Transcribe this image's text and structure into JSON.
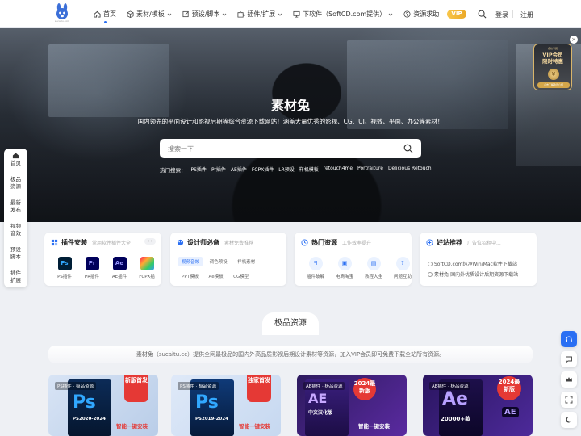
{
  "header": {
    "logo_sub": "sucaitu.com",
    "nav": [
      {
        "label": "首页",
        "icon": "home-icon",
        "active": true,
        "caret": false
      },
      {
        "label": "素材/模板",
        "icon": "box-icon",
        "active": false,
        "caret": true
      },
      {
        "label": "预设/脚本",
        "icon": "edit-icon",
        "active": false,
        "caret": true
      },
      {
        "label": "插件/扩展",
        "icon": "puzzle-icon",
        "active": false,
        "caret": true
      },
      {
        "label": "下软件（SoftCD.com提供）",
        "icon": "monitor-icon",
        "active": false,
        "caret": true
      },
      {
        "label": "资源求助",
        "icon": "help-icon",
        "active": false,
        "caret": false
      }
    ],
    "vip": "VIP",
    "login": "登录",
    "register": "注册"
  },
  "hero": {
    "title": "素材兔",
    "subtitle": "国内领先的平面设计和影视后期等综合资源下载网站！涵盖大量优秀的影视、CG、UI、视效、平面、办公等素材！",
    "search_placeholder": "搜索一下",
    "hot_label": "热门搜索：",
    "hot_terms": [
      "PS插件",
      "Pr插件",
      "AE插件",
      "FCPX插件",
      "LR预设",
      "样机模板",
      "retouch4me",
      "Portraiture",
      "Delicious Retouch"
    ]
  },
  "vip_badge": {
    "top": "名校专属",
    "title_line1": "VIP会员",
    "title_line2": "限时特惠",
    "coin": "¥",
    "button": "点击了解会员介绍"
  },
  "left_sidebar": [
    {
      "label": "首页",
      "icon": "home-icon"
    },
    {
      "label": "极品资源"
    },
    {
      "label": "最新发布"
    },
    {
      "label": "视频音效"
    },
    {
      "label": "预设脚本"
    },
    {
      "label": "插件扩展"
    }
  ],
  "cards": {
    "plugins": {
      "title": "插件安装",
      "subtitle": "常用软件插件大全",
      "arrows": "‹ ›",
      "items": [
        {
          "label": "PS插件",
          "abbr": "Ps",
          "color": "#001e36",
          "text_color": "#31a8ff"
        },
        {
          "label": "PR插件",
          "abbr": "Pr",
          "color": "#00005b",
          "text_color": "#9999ff"
        },
        {
          "label": "AE插件",
          "abbr": "Ae",
          "color": "#00005b",
          "text_color": "#9999ff"
        },
        {
          "label": "FCPX插",
          "abbr": "🎬",
          "color": "#222222",
          "text_color": "#ffffff"
        }
      ]
    },
    "design": {
      "title": "设计师必备",
      "subtitle": "素材免费推荐",
      "tags": [
        "视频音效",
        "调色预设",
        "样机素材",
        "PPT模板",
        "Ae模板",
        "CG模型"
      ]
    },
    "hot": {
      "title": "热门资源",
      "subtitle": "工作效率提升",
      "items": [
        {
          "label": "插件破解",
          "icon": "wrench-icon"
        },
        {
          "label": "电商淘宝",
          "icon": "bag-icon"
        },
        {
          "label": "教程大全",
          "icon": "book-icon"
        },
        {
          "label": "问题互助",
          "icon": "question-icon"
        }
      ]
    },
    "links": {
      "title": "好站推荐",
      "subtitle": "广告位招租中...",
      "items": [
        "SoftCD.com纯净Win/Mac软件下载站",
        "素材兔-国内外优质设计后期资源下载站"
      ]
    }
  },
  "section": {
    "title": "极品资源",
    "notice": "素材兔（sucaitu.cc）提供全网最极品的国内外高品质影视后期设计素材等资源，加入VIP会员即可免费下载全站所有资源。"
  },
  "products": [
    {
      "label": "PS插件 · 极品资源",
      "big": "Ps",
      "sub": "PS2020-2024",
      "corner": "新版首发",
      "bottom": "智能一键安装"
    },
    {
      "label": "PS插件 · 极品资源",
      "big": "Ps",
      "sub": "PS2019-2024",
      "corner": "独家首发",
      "bottom": "智能一键安装"
    },
    {
      "label": "AE插件 · 极品资源",
      "big": "AE",
      "sub": "中文汉化版",
      "corner": "2024最新版",
      "bottom": "智能一键安装"
    },
    {
      "label": "AE插件 · 极品资源",
      "big": "Ae",
      "sub": "20000+款",
      "corner": "2024最新版",
      "bottom": "AE"
    }
  ],
  "colors": {
    "accent": "#2a6ff3",
    "vip_gold": "#eba826"
  }
}
